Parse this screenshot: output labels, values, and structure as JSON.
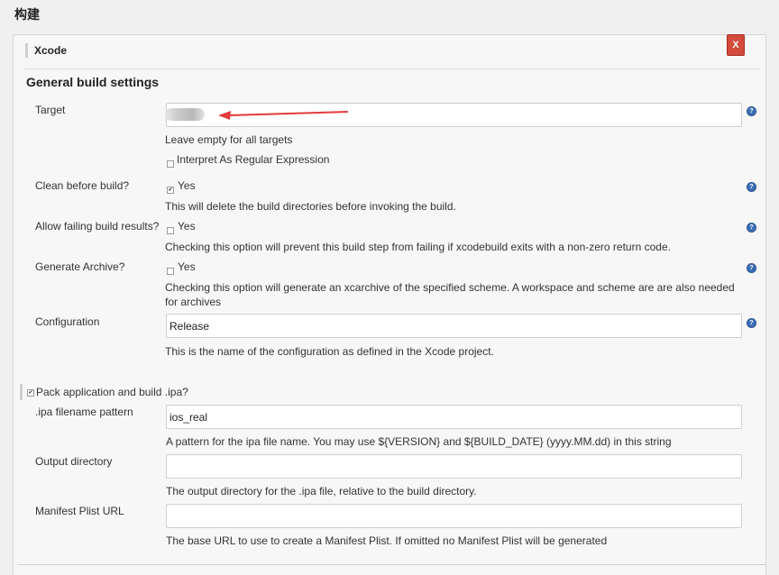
{
  "section_title": "构建",
  "step": {
    "title": "Xcode",
    "delete_label": "X",
    "subhead": "General build settings"
  },
  "help_label": "?",
  "target": {
    "label": "Target",
    "value": "",
    "desc": "Leave empty for all targets",
    "regex_label": "Interpret As Regular Expression",
    "regex_checked": false
  },
  "clean": {
    "label": "Clean before build?",
    "option": "Yes",
    "checked": true,
    "desc": "This will delete the build directories before invoking the build."
  },
  "allow_failing": {
    "label": "Allow failing build results?",
    "option": "Yes",
    "checked": false,
    "desc": "Checking this option will prevent this build step from failing if xcodebuild exits with a non-zero return code."
  },
  "archive": {
    "label": "Generate Archive?",
    "option": "Yes",
    "checked": false,
    "desc_line1": "Checking this option will generate an xcarchive of the specified scheme. A workspace and scheme are are also needed",
    "desc_line2": "for archives"
  },
  "configuration": {
    "label": "Configuration",
    "value": "Release",
    "desc": "This is the name of the configuration as defined in the Xcode project."
  },
  "pack": {
    "label": "Pack application and build .ipa?",
    "checked": true
  },
  "ipa_pattern": {
    "label": ".ipa filename pattern",
    "value": "ios_real",
    "desc": "A pattern for the ipa file name. You may use ${VERSION} and ${BUILD_DATE} (yyyy.MM.dd) in this string"
  },
  "output_dir": {
    "label": "Output directory",
    "value": "",
    "desc": "The output directory for the .ipa file, relative to the build directory."
  },
  "manifest": {
    "label": "Manifest Plist URL",
    "value": "",
    "desc": "The base URL to use to create a Manifest Plist. If omitted no Manifest Plist will be generated"
  },
  "colors": {
    "delete_button": "#d24b3b",
    "annotation_arrow": "#e53a3a",
    "help_icon": "#3c6fb5"
  }
}
